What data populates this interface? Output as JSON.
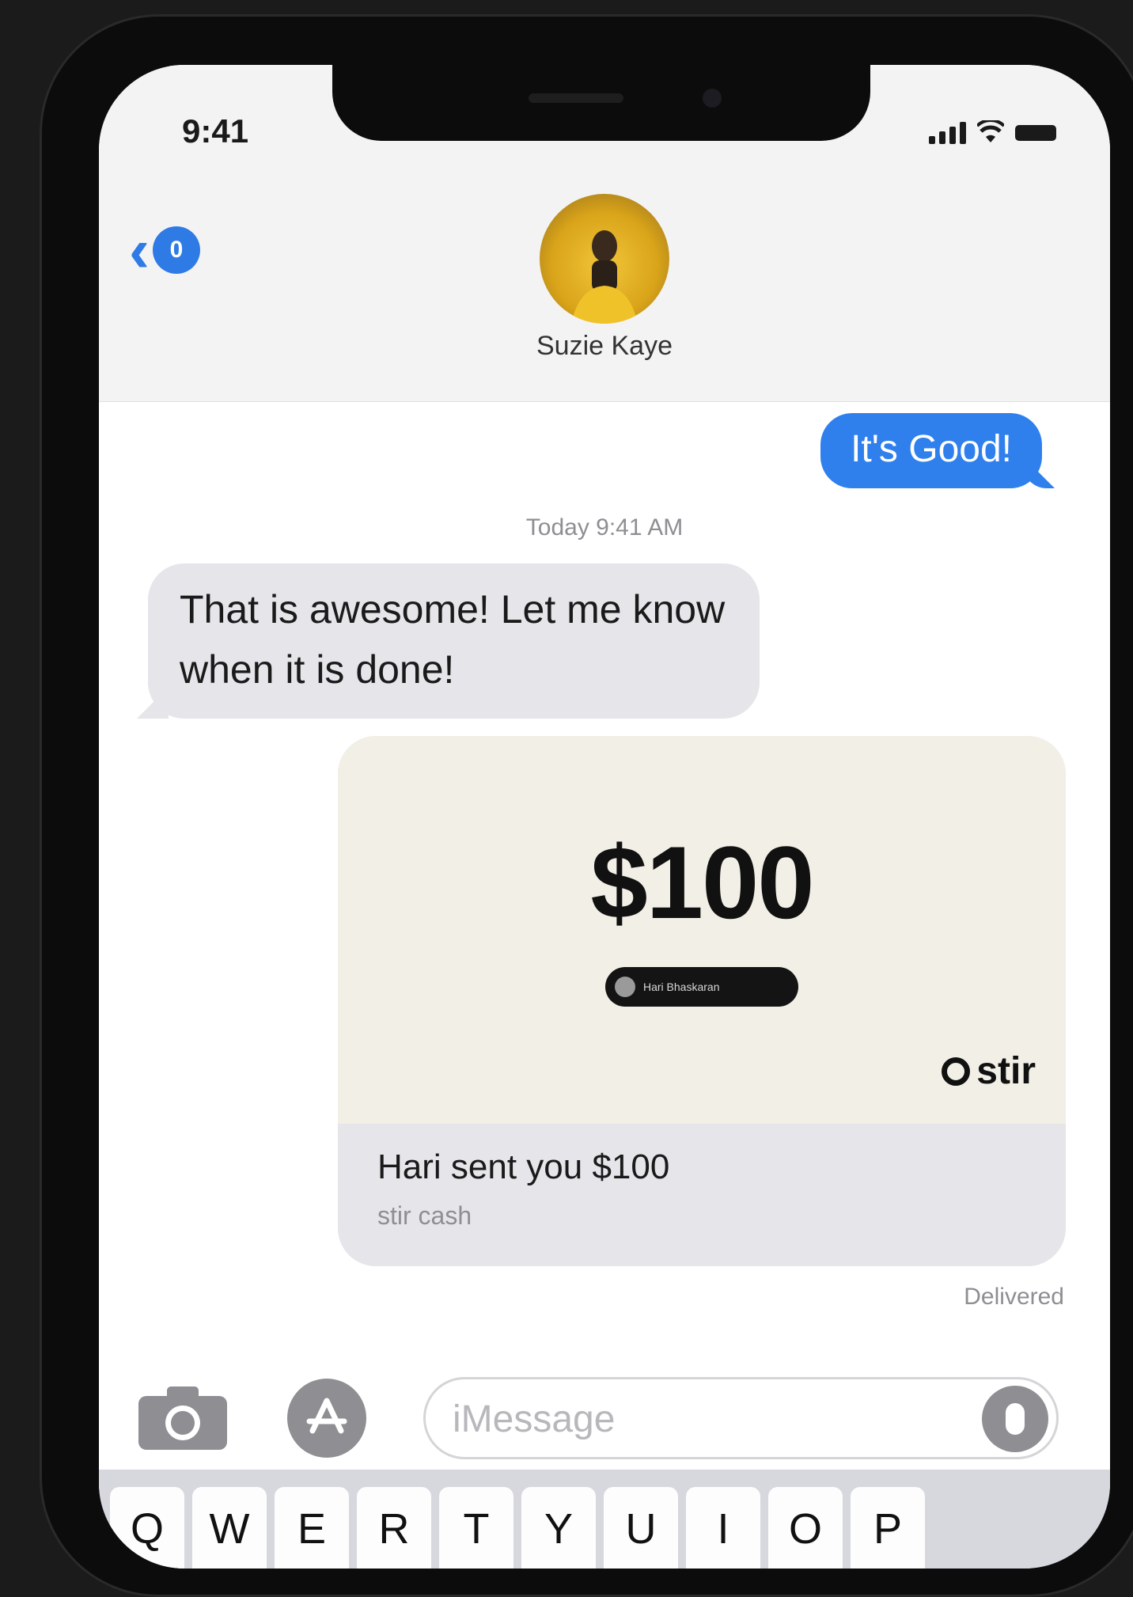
{
  "status_bar": {
    "time": "9:41",
    "icons": [
      "signal-icon",
      "wifi-icon",
      "battery-icon"
    ]
  },
  "header": {
    "back_count": "0",
    "contact_name": "Suzie Kaye"
  },
  "messages": {
    "outgoing_1": "It's Good!",
    "timestamp": "Today 9:41 AM",
    "incoming_1": "That is awesome! Let me know when it is done!"
  },
  "payment": {
    "amount": "$100",
    "pill_text": "Hari Bhaskaran",
    "brand": "stir",
    "caption": "Hari sent you $100",
    "sub": "stir cash"
  },
  "delivery_status": "Delivered",
  "composer": {
    "placeholder": "iMessage"
  },
  "keyboard": {
    "keys": [
      "Q",
      "W",
      "E",
      "R",
      "T",
      "Y",
      "U",
      "I",
      "O",
      "P"
    ]
  },
  "colors": {
    "imessage_blue": "#2f80ed",
    "incoming_gray": "#e5e5ea",
    "card_cream": "#f2efe6"
  }
}
